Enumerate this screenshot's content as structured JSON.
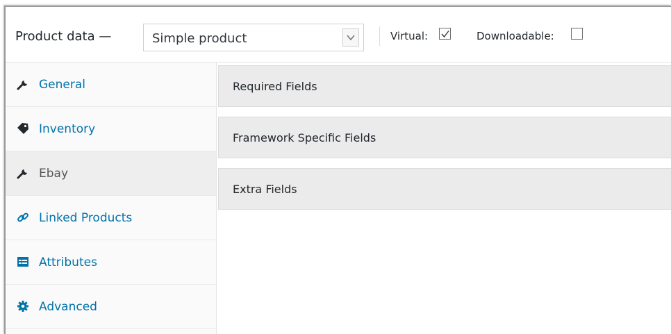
{
  "header": {
    "title": "Product data —",
    "product_type": "Simple product",
    "virtual_label": "Virtual:",
    "virtual_checked": true,
    "downloadable_label": "Downloadable:",
    "downloadable_checked": false
  },
  "sidebar": {
    "items": [
      {
        "label": "General",
        "icon": "wrench-icon",
        "active": false
      },
      {
        "label": "Inventory",
        "icon": "tag-icon",
        "active": false
      },
      {
        "label": "Ebay",
        "icon": "wrench-icon",
        "active": true
      },
      {
        "label": "Linked Products",
        "icon": "link-icon",
        "active": false
      },
      {
        "label": "Attributes",
        "icon": "list-icon",
        "active": false
      },
      {
        "label": "Advanced",
        "icon": "gear-icon",
        "active": false
      }
    ]
  },
  "main": {
    "panels": [
      {
        "label": "Required Fields"
      },
      {
        "label": "Framework Specific Fields"
      },
      {
        "label": "Extra Fields"
      }
    ]
  },
  "colors": {
    "link": "#0073aa",
    "active_text": "#555555",
    "panel_bg": "#ebebeb"
  }
}
